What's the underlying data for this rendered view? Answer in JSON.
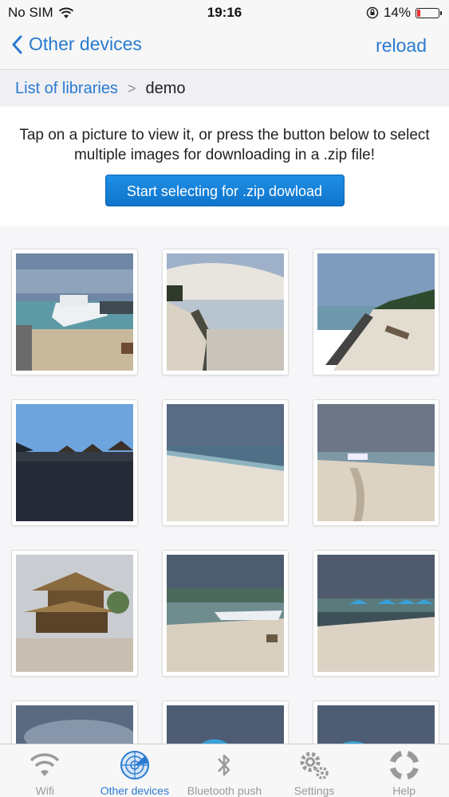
{
  "status_bar": {
    "carrier": "No SIM",
    "time": "19:16",
    "battery": "14%"
  },
  "nav": {
    "back_label": "Other devices",
    "reload_label": "reload"
  },
  "breadcrumb": {
    "root": "List of libraries",
    "separator": ">",
    "current": "demo"
  },
  "instructions": {
    "text": "Tap on a picture to view it, or press the button below to select multiple images for downloading in a .zip file!",
    "button_label": "Start selecting for .zip dowload"
  },
  "photos": [
    {
      "scene": "boat-beach"
    },
    {
      "scene": "shore-clouds"
    },
    {
      "scene": "beach-log"
    },
    {
      "scene": "huts-silhouette"
    },
    {
      "scene": "beach-wide"
    },
    {
      "scene": "beach-boat-small"
    },
    {
      "scene": "thatched-hut"
    },
    {
      "scene": "boat-shore"
    },
    {
      "scene": "umbrellas"
    },
    {
      "scene": "partial-sky"
    },
    {
      "scene": "partial-umbrella"
    },
    {
      "scene": "partial-umbrella-2"
    }
  ],
  "tabs": [
    {
      "label": "Wifi",
      "icon": "wifi-icon"
    },
    {
      "label": "Other devices",
      "icon": "radar-icon"
    },
    {
      "label": "Bluetooth push",
      "icon": "bluetooth-icon"
    },
    {
      "label": "Settings",
      "icon": "gears-icon"
    },
    {
      "label": "Help",
      "icon": "lifebuoy-icon"
    }
  ],
  "colors": {
    "accent": "#2a7ad0",
    "battery_low": "#e8312f",
    "button": "#1e8fe4"
  }
}
